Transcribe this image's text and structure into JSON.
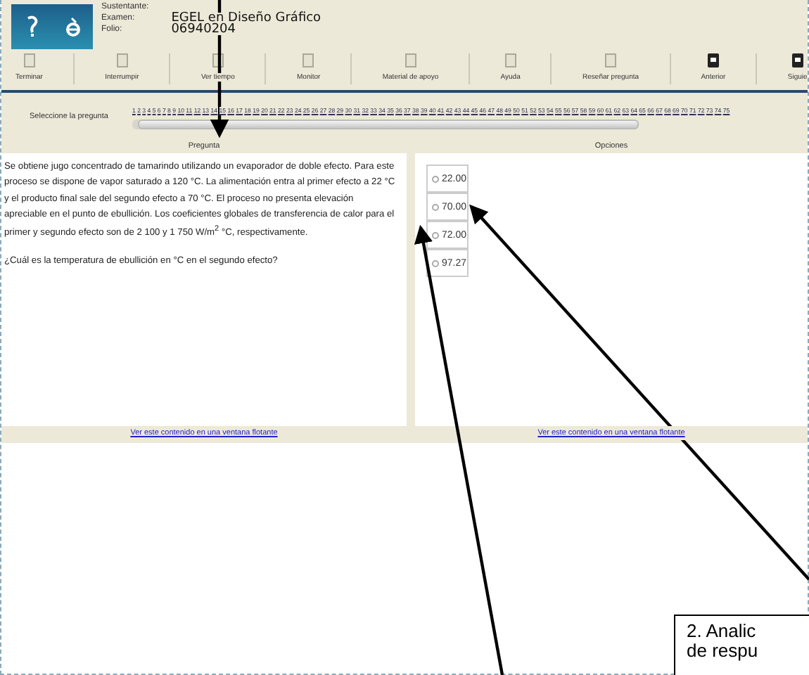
{
  "header": {
    "fields": [
      {
        "label": "Sustentante:"
      },
      {
        "label": "Examen:",
        "value": "EGEL en Diseño Gráfico"
      },
      {
        "label": "Folio:",
        "value": "06940204"
      }
    ]
  },
  "toolbar": [
    {
      "label": "Terminar",
      "kind": "action"
    },
    {
      "label": "Interrumpir",
      "kind": "action"
    },
    {
      "label": "Ver tiempo",
      "kind": "action"
    },
    {
      "label": "Monitor",
      "kind": "action"
    },
    {
      "label": "Material de apoyo",
      "kind": "action"
    },
    {
      "label": "Ayuda",
      "kind": "action"
    },
    {
      "label": "Reseñar pregunta",
      "kind": "action"
    },
    {
      "label": "Anterior",
      "kind": "nav"
    },
    {
      "label": "Siguie",
      "kind": "nav"
    }
  ],
  "question_nav": {
    "label": "Seleccione la pregunta",
    "numbers": [
      "1",
      "2",
      "3",
      "4",
      "5",
      "6",
      "7",
      "8",
      "9",
      "10",
      "11",
      "12",
      "13",
      "14",
      "15",
      "16",
      "17",
      "18",
      "19",
      "20",
      "21",
      "22",
      "23",
      "24",
      "25",
      "26",
      "27",
      "28",
      "29",
      "30",
      "31",
      "32",
      "33",
      "34",
      "35",
      "36",
      "37",
      "38",
      "39",
      "40",
      "41",
      "42",
      "43",
      "44",
      "45",
      "46",
      "47",
      "48",
      "49",
      "50",
      "51",
      "52",
      "53",
      "54",
      "55",
      "56",
      "57",
      "58",
      "59",
      "60",
      "61",
      "62",
      "63",
      "64",
      "65",
      "66",
      "67",
      "68",
      "69",
      "70",
      "71",
      "72",
      "73",
      "74",
      "75"
    ]
  },
  "question": {
    "heading": "Pregunta",
    "text": "Se obtiene jugo concentrado de tamarindo utilizando un evaporador de doble efecto. Para este proceso se dispone de vapor saturado a 120 °C. La alimentación entra al primer efecto a 22 °C y el producto final sale del segundo efecto a 70 °C. El proceso no presenta elevación apreciable en el punto de ebullición. Los coeficientes globales de transferencia de calor para el primer y segundo efecto son de 2 100 y 1 750 W/m$^{2}$ °C, respectivamente.",
    "prompt": "¿Cuál es la temperatura de ebullición en °C en el segundo efecto?",
    "link": "Ver este contenido en una ventana flotante"
  },
  "options": {
    "heading": "Opciones",
    "items": [
      {
        "label": "22.00",
        "selected": false
      },
      {
        "label": "70.00",
        "selected": false
      },
      {
        "label": "72.00",
        "selected": false
      },
      {
        "label": "97.27",
        "selected": false
      }
    ],
    "link": "Ver este contenido en una ventana flotante"
  },
  "callout": {
    "lines": [
      "2. Analic",
      "de respu"
    ]
  }
}
